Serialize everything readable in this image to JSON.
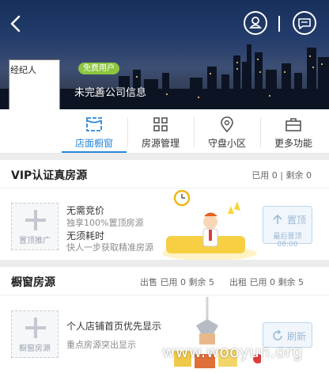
{
  "header": {
    "avatar_label": "经纪人",
    "user_badge": "免费用户",
    "company_text": "未完善公司信息"
  },
  "tabs": [
    {
      "label": "店面橱窗",
      "icon": "storefront-icon",
      "active": true
    },
    {
      "label": "房源管理",
      "icon": "grid-icon",
      "active": false
    },
    {
      "label": "守盘小区",
      "icon": "map-pin-icon",
      "active": false
    },
    {
      "label": "更多功能",
      "icon": "briefcase-icon",
      "active": false
    }
  ],
  "vip": {
    "title": "VIP认证真房源",
    "stats": "已用 0  |  剩余 0",
    "add_label": "置顶推广",
    "line1": "无需竞价",
    "line2": "独享100%置顶房源",
    "line3": "无须耗时",
    "line4": "快人一步获取精准房源",
    "button_label": "置顶",
    "button_note": "最后置顶08:00"
  },
  "window": {
    "title": "橱窗房源",
    "sale_stats": "出售 已用 0 剩余 5",
    "rent_stats": "出租 已用 0 剩余 5",
    "add_label": "橱窗房源",
    "line1": "个人店铺首页优先显示",
    "line2": "重点房源突出显示",
    "button_label": "刷新"
  },
  "watermark": "www.wooyun.org",
  "colors": {
    "accent": "#2b88d8",
    "badge": "#8cc63f"
  }
}
